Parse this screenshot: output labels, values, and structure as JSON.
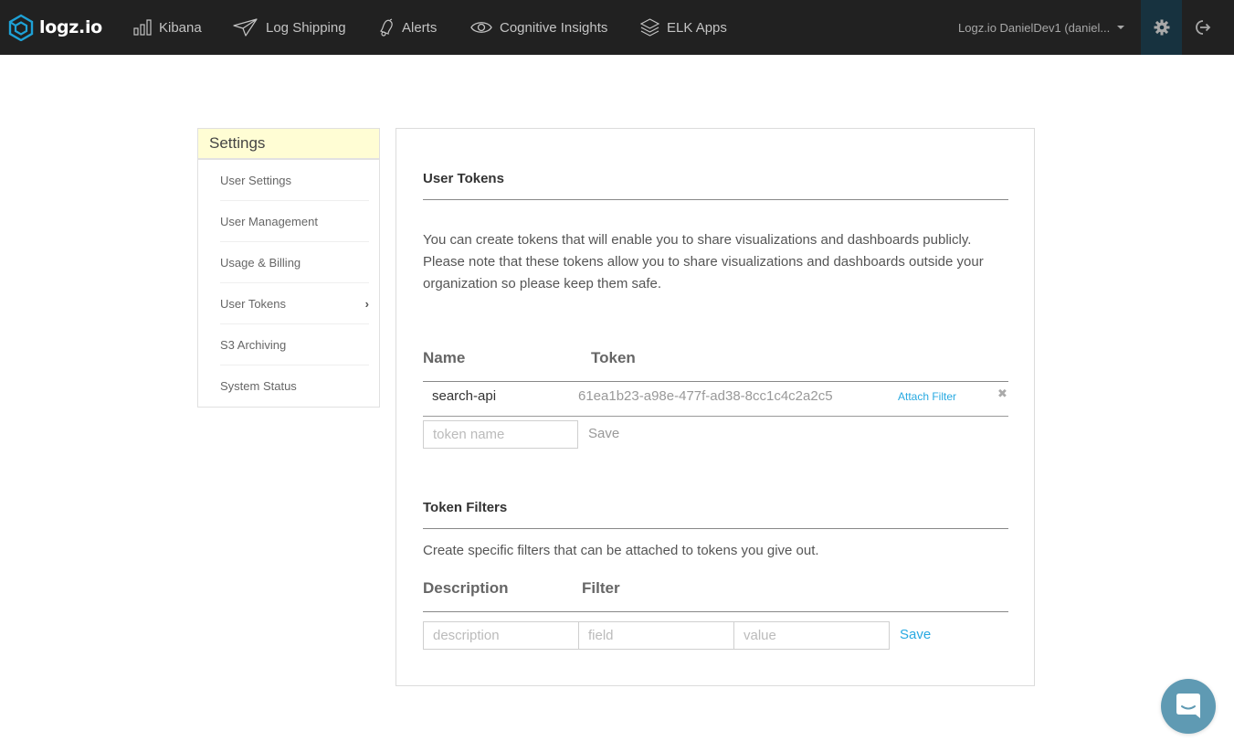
{
  "brand": {
    "name": "logz.io",
    "accent": "#1ea1d6"
  },
  "nav": {
    "items": [
      {
        "label": "Kibana",
        "icon": "bar-chart-icon"
      },
      {
        "label": "Log Shipping",
        "icon": "paper-plane-icon"
      },
      {
        "label": "Alerts",
        "icon": "bell-icon"
      },
      {
        "label": "Cognitive Insights",
        "icon": "eye-icon"
      },
      {
        "label": "ELK Apps",
        "icon": "layers-icon"
      }
    ],
    "account": "Logz.io DanielDev1 (daniel...",
    "settings_icon": "gear-icon",
    "logout_icon": "logout-icon"
  },
  "sidebar": {
    "title": "Settings",
    "items": [
      {
        "label": "User Settings"
      },
      {
        "label": "User Management"
      },
      {
        "label": "Usage & Billing"
      },
      {
        "label": "User Tokens",
        "active": true,
        "chevron": "›"
      },
      {
        "label": "S3 Archiving"
      },
      {
        "label": "System Status"
      }
    ]
  },
  "user_tokens": {
    "title": "User Tokens",
    "description": "You can create tokens that will enable you to share visualizations and dashboards publicly. Please note that these tokens allow you to share visualizations and dashboards outside your organization so please keep them safe.",
    "columns": [
      "Name",
      "Token"
    ],
    "rows": [
      {
        "name": "search-api",
        "token": "61ea1b23-a98e-477f-ad38-8cc1c4c2a2c5",
        "action": "Attach Filter",
        "remove": "✖"
      }
    ],
    "new_token": {
      "placeholder": "token name",
      "value": "",
      "save_label": "Save"
    }
  },
  "token_filters": {
    "title": "Token Filters",
    "description": "Create specific filters that can be attached to tokens you give out.",
    "columns": [
      "Description",
      "Filter"
    ],
    "inputs": {
      "description_placeholder": "description",
      "field_placeholder": "field",
      "value_placeholder": "value"
    },
    "save_label": "Save"
  },
  "chat": {
    "icon": "chat-bubble-icon"
  }
}
